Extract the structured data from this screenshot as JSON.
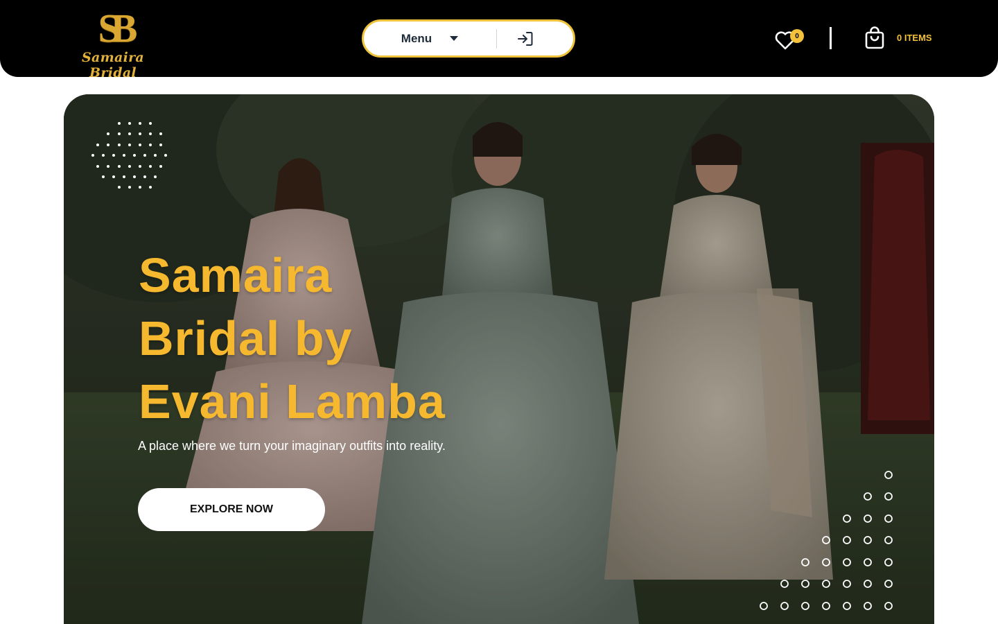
{
  "header": {
    "logo": {
      "monogram": "SB",
      "brand_name": "Samaira Bridal"
    },
    "nav": {
      "menu_label": "Menu"
    },
    "wishlist": {
      "count": "0"
    },
    "cart": {
      "label": "0 ITEMS"
    },
    "colors": {
      "background": "#000000",
      "accent": "#f3c13a"
    }
  },
  "hero": {
    "title_lines": [
      "Samaira",
      "Bridal by",
      "Evani Lamba"
    ],
    "subtitle": "A place where we turn your imaginary outfits into reality.",
    "cta_label": "EXPLORE NOW",
    "colors": {
      "title": "#f5b82e",
      "cta_bg": "#ffffff"
    }
  },
  "icons": {
    "menu_caret": "chevron-down-icon",
    "login": "sign-in-icon",
    "wishlist": "heart-icon",
    "cart": "shopping-bag-icon"
  }
}
